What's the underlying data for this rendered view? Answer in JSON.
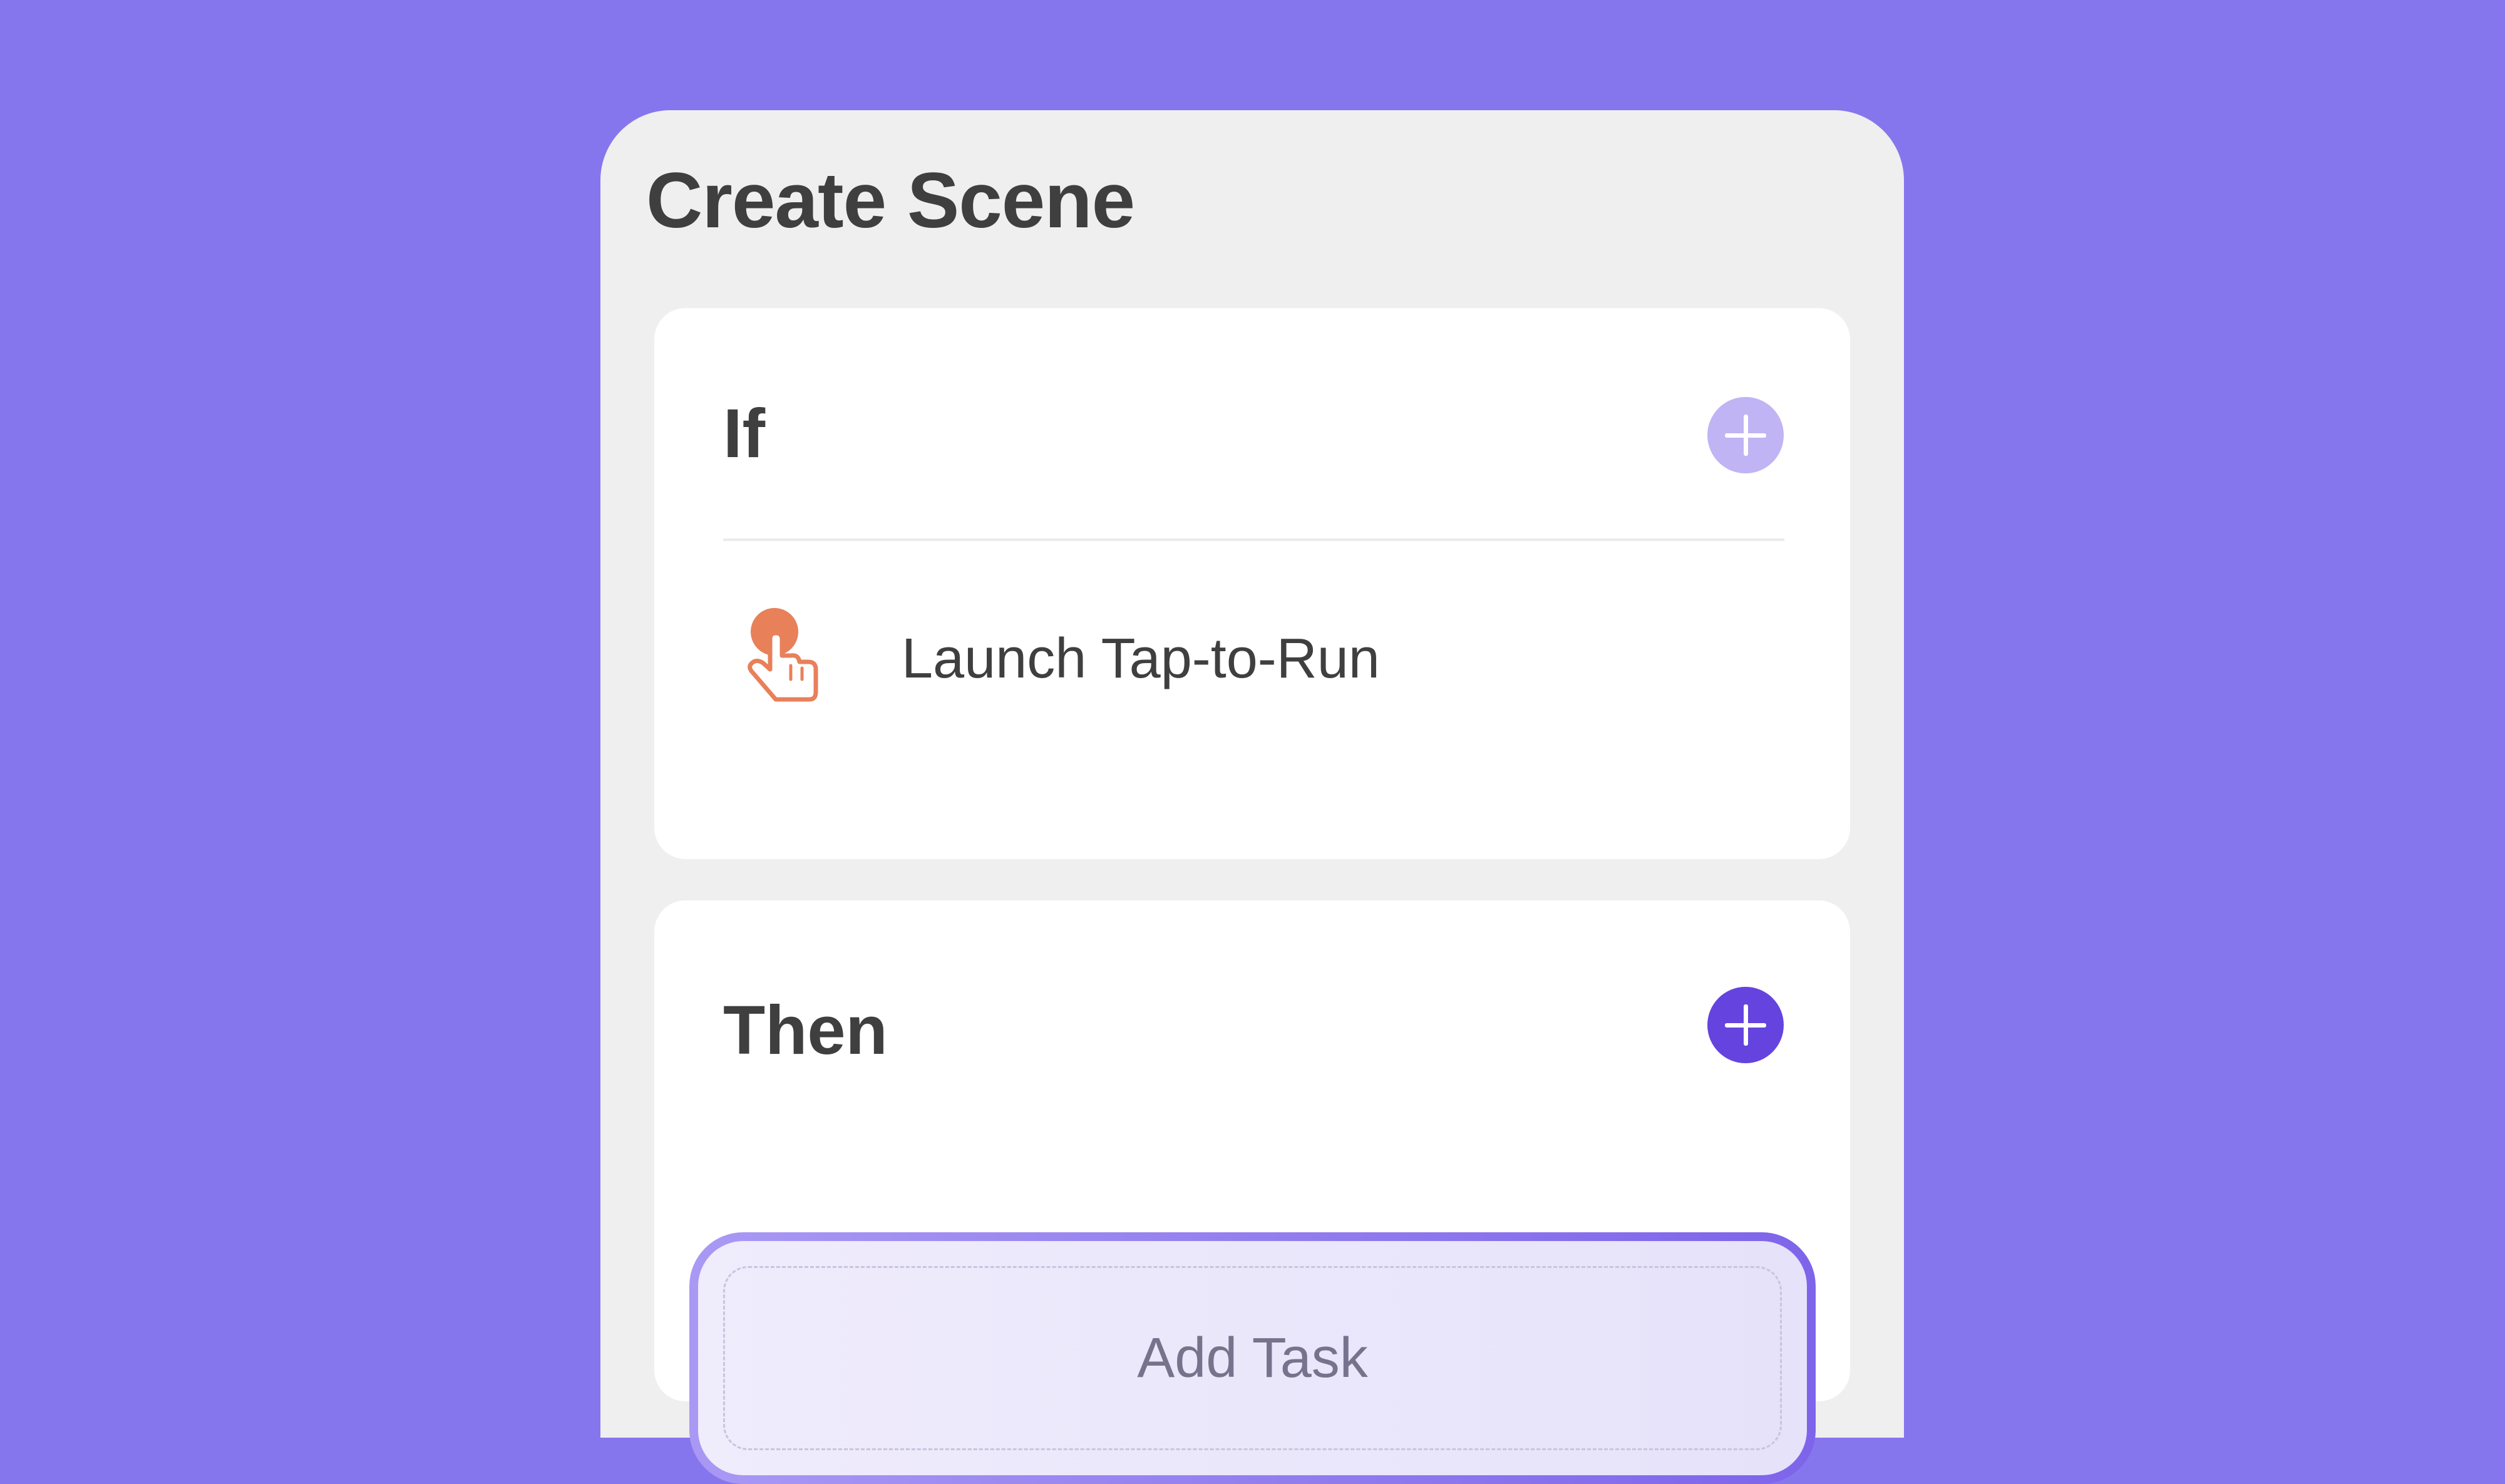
{
  "page": {
    "title": "Create Scene"
  },
  "if_section": {
    "title": "If",
    "add_button_icon": "plus-icon",
    "add_button_color": "#C0B4F4",
    "conditions": [
      {
        "icon": "tap-hand-icon",
        "icon_color": "#E8805A",
        "label": "Launch Tap-to-Run"
      }
    ]
  },
  "then_section": {
    "title": "Then",
    "add_button_icon": "plus-icon",
    "add_button_color": "#6543DF",
    "add_task_label": "Add Task"
  },
  "colors": {
    "background": "#8676EE",
    "panel": "#EFEFEF",
    "card": "#FFFFFF",
    "accent": "#6543DF"
  }
}
